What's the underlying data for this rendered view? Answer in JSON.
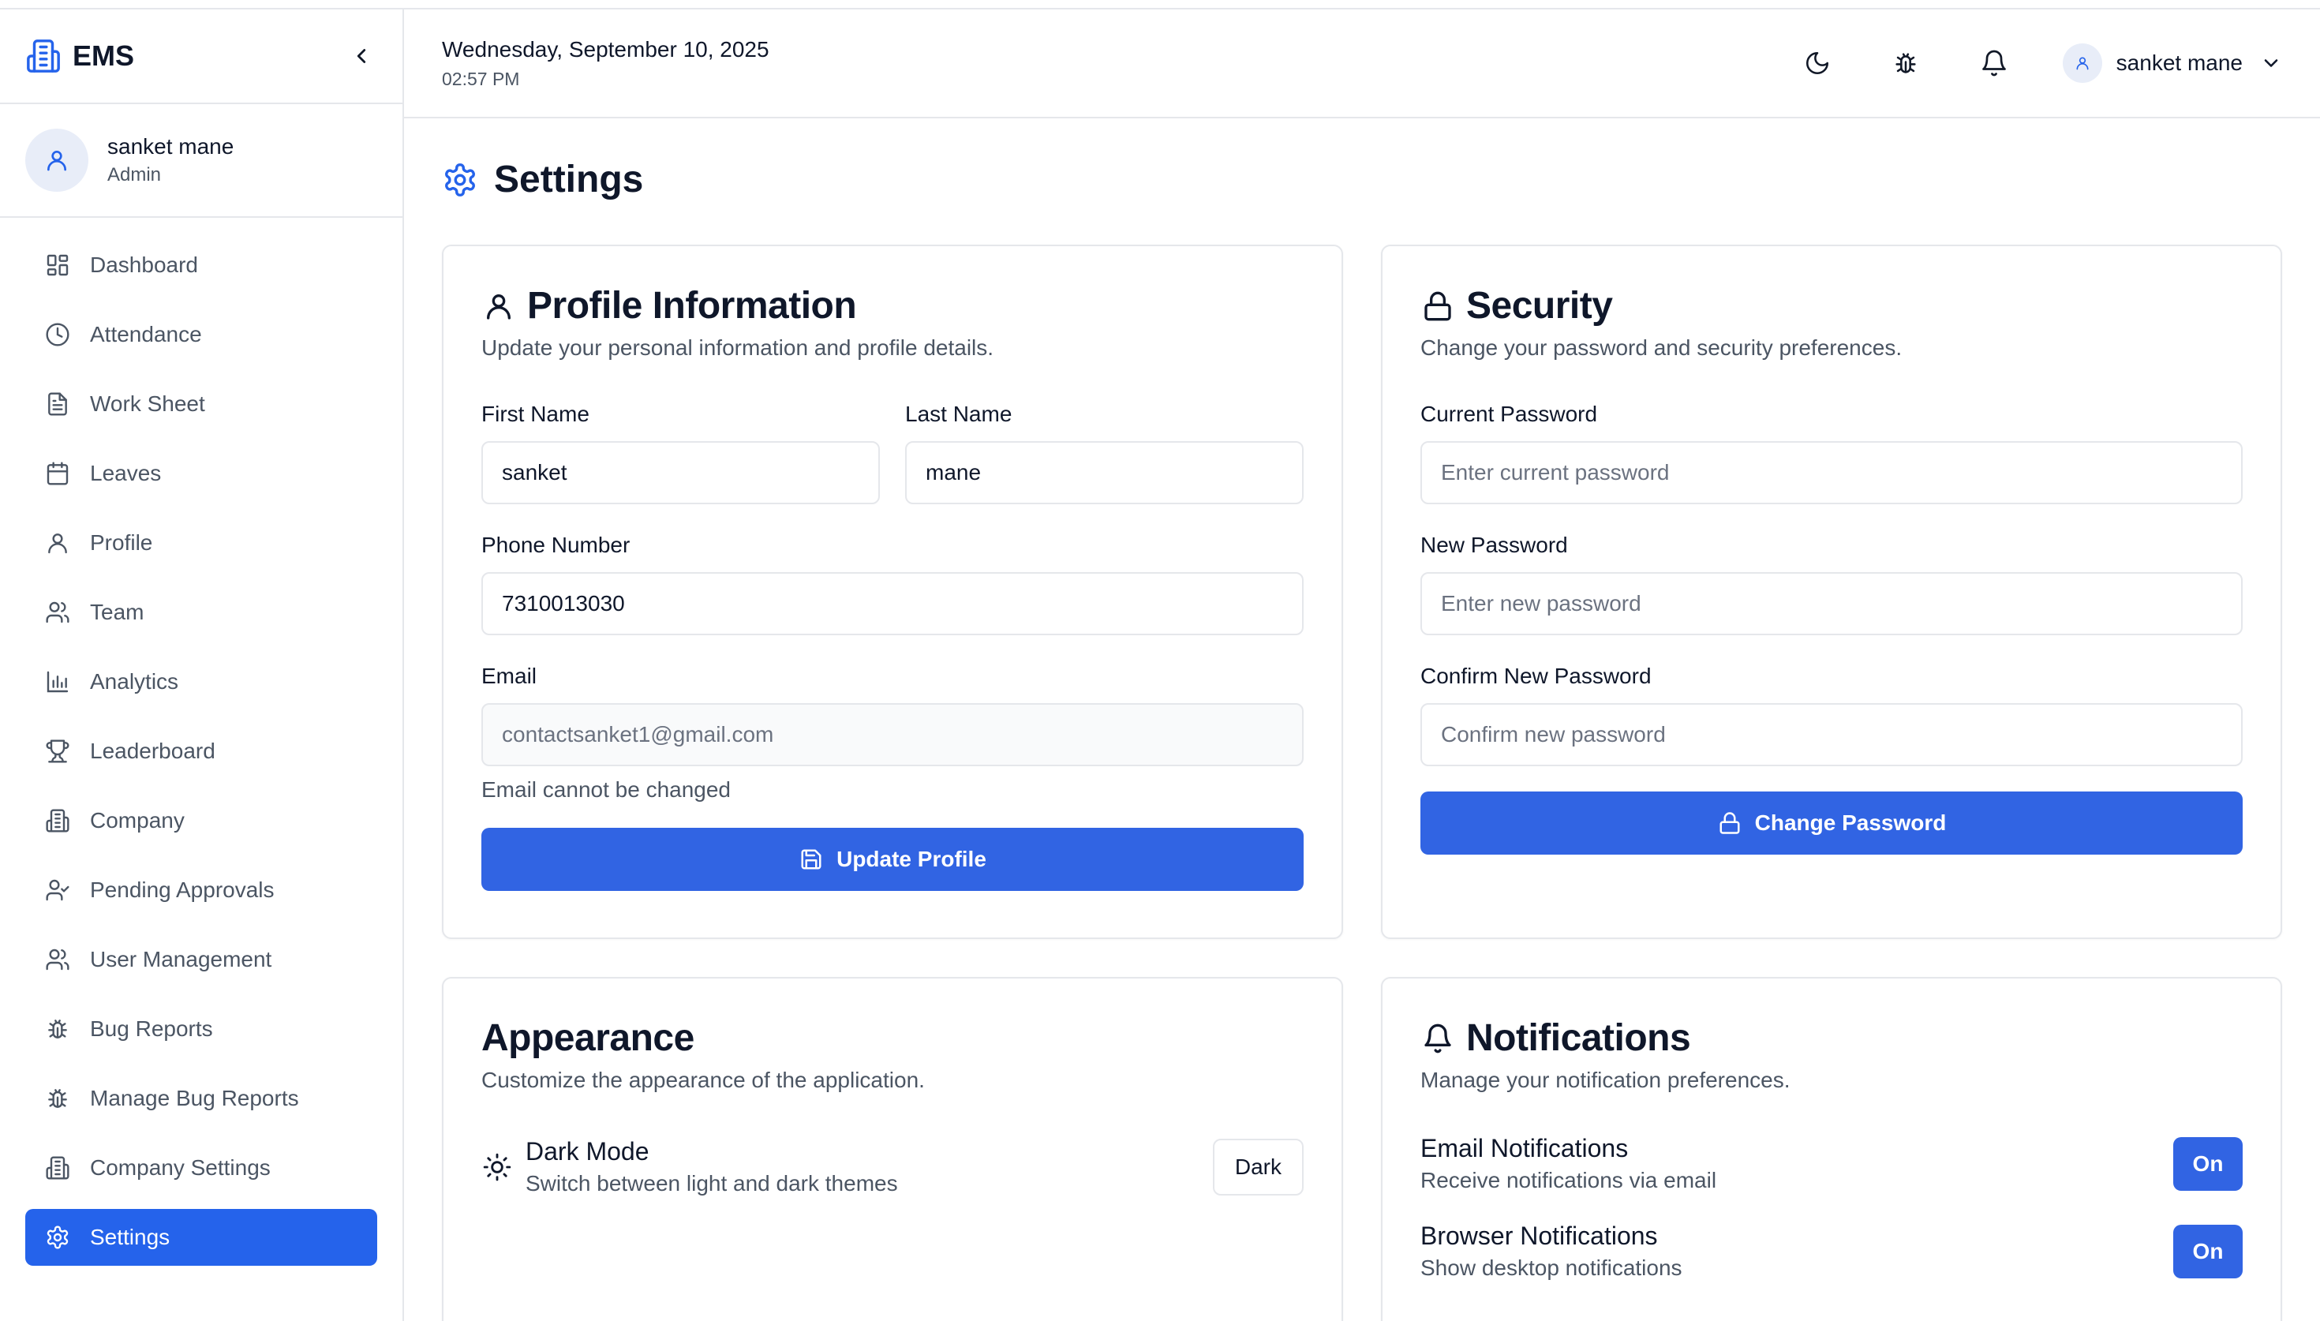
{
  "app": {
    "name": "EMS"
  },
  "user": {
    "name": "sanket mane",
    "role": "Admin"
  },
  "sidebar": {
    "items": [
      {
        "label": "Dashboard",
        "icon": "dashboard-icon"
      },
      {
        "label": "Attendance",
        "icon": "clock-icon"
      },
      {
        "label": "Work Sheet",
        "icon": "document-icon"
      },
      {
        "label": "Leaves",
        "icon": "calendar-icon"
      },
      {
        "label": "Profile",
        "icon": "user-icon"
      },
      {
        "label": "Team",
        "icon": "users-icon"
      },
      {
        "label": "Analytics",
        "icon": "bar-chart-icon"
      },
      {
        "label": "Leaderboard",
        "icon": "trophy-icon"
      },
      {
        "label": "Company",
        "icon": "building-icon"
      },
      {
        "label": "Pending Approvals",
        "icon": "user-check-icon"
      },
      {
        "label": "User Management",
        "icon": "users-icon"
      },
      {
        "label": "Bug Reports",
        "icon": "bug-icon"
      },
      {
        "label": "Manage Bug Reports",
        "icon": "bug-icon"
      },
      {
        "label": "Company Settings",
        "icon": "building-icon"
      },
      {
        "label": "Settings",
        "icon": "gear-icon",
        "active": true
      }
    ]
  },
  "header": {
    "date": "Wednesday, September 10, 2025",
    "time": "02:57 PM",
    "user_name": "sanket mane"
  },
  "page": {
    "title": "Settings"
  },
  "profile": {
    "title": "Profile Information",
    "description": "Update your personal information and profile details.",
    "first_name_label": "First Name",
    "first_name_value": "sanket",
    "last_name_label": "Last Name",
    "last_name_value": "mane",
    "phone_label": "Phone Number",
    "phone_value": "7310013030",
    "email_label": "Email",
    "email_value": "contactsanket1@gmail.com",
    "email_hint": "Email cannot be changed",
    "submit_label": "Update Profile"
  },
  "security": {
    "title": "Security",
    "description": "Change your password and security preferences.",
    "current_label": "Current Password",
    "current_placeholder": "Enter current password",
    "new_label": "New Password",
    "new_placeholder": "Enter new password",
    "confirm_label": "Confirm New Password",
    "confirm_placeholder": "Confirm new password",
    "submit_label": "Change Password"
  },
  "appearance": {
    "title": "Appearance",
    "description": "Customize the appearance of the application.",
    "dark_mode_title": "Dark Mode",
    "dark_mode_desc": "Switch between light and dark themes",
    "dark_mode_button": "Dark"
  },
  "notifications": {
    "title": "Notifications",
    "description": "Manage your notification preferences.",
    "email_title": "Email Notifications",
    "email_desc": "Receive notifications via email",
    "email_state": "On",
    "browser_title": "Browser Notifications",
    "browser_desc": "Show desktop notifications",
    "browser_state": "On"
  },
  "colors": {
    "accent": "#2563eb",
    "border": "#e5e7eb",
    "muted": "#4b5563"
  }
}
